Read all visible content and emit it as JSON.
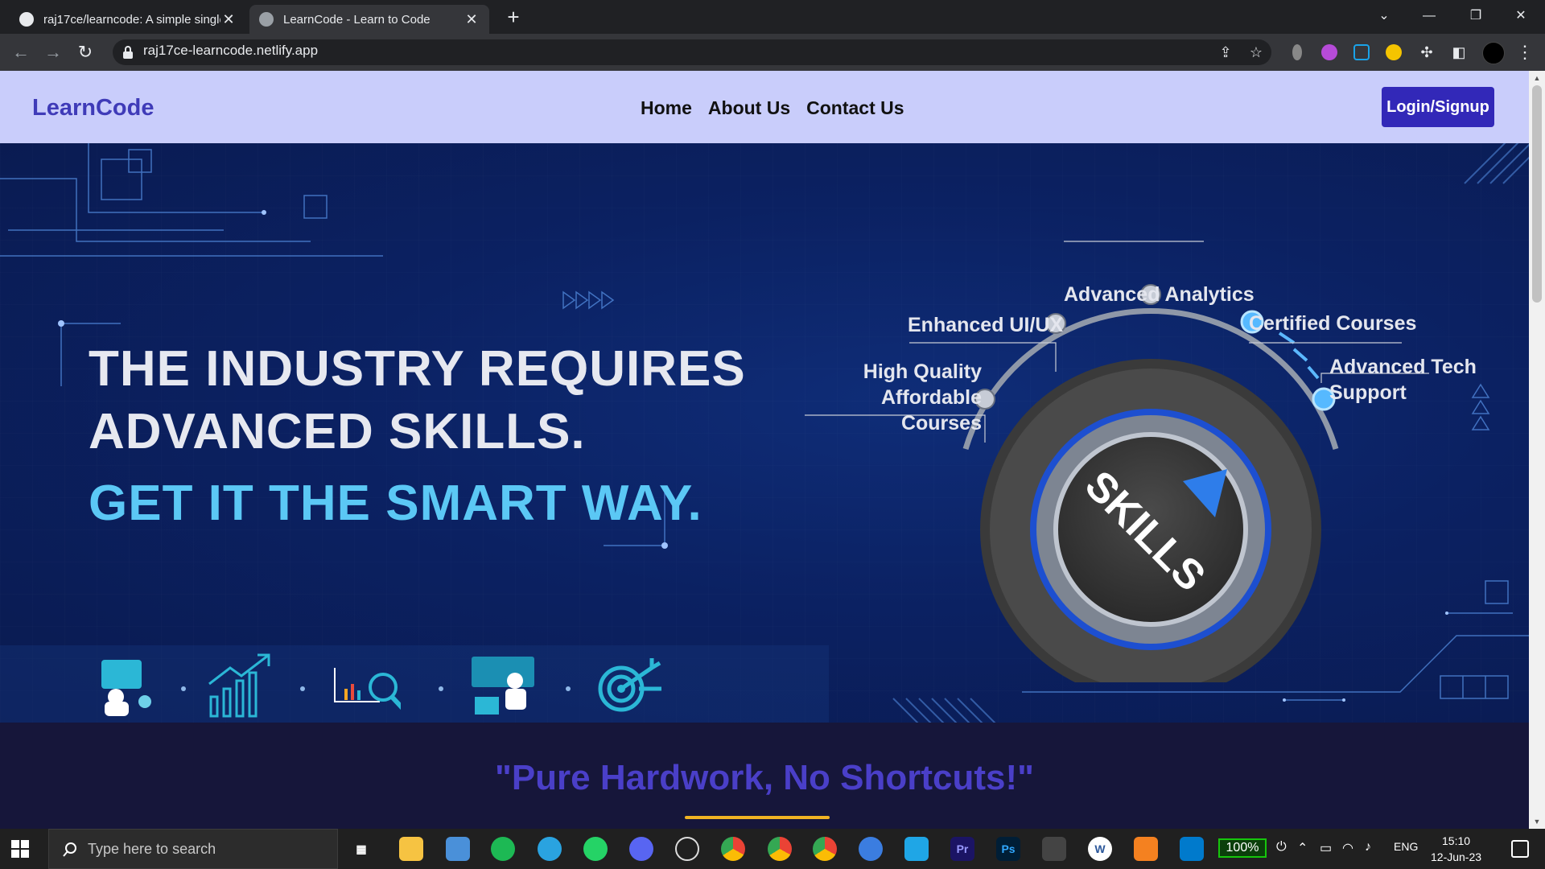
{
  "browser": {
    "tabs": [
      {
        "title": "raj17ce/learncode: A simple single",
        "favicon": "github-icon",
        "active": false
      },
      {
        "title": "LearnCode - Learn to Code",
        "favicon": "globe-icon",
        "active": true
      }
    ],
    "new_tab": "+",
    "url": "raj17ce-learncode.netlify.app"
  },
  "site": {
    "brand": "LearnCode",
    "nav": [
      "Home",
      "About Us",
      "Contact Us"
    ],
    "login_label": "Login/Signup",
    "brand_color": "#3f3bb8",
    "nav_bg": "#c9cdfb"
  },
  "hero": {
    "line1": "THE INDUSTRY REQUIRES",
    "line2": "ADVANCED SKILLS.",
    "line3": "GET IT THE SMART WAY.",
    "dial_text": "SKILLS",
    "skills": [
      "High Quality Affordable Courses",
      "Enhanced UI/UX",
      "Advanced Analytics",
      "Certified Courses",
      "Advanced Tech Support"
    ],
    "skill_lines": {
      "hq1": "High Quality",
      "hq2": "Affordable Courses",
      "ui": "Enhanced UI/UX",
      "aa": "Advanced Analytics",
      "cc": "Certified Courses",
      "ts1": "Advanced Tech",
      "ts2": "Support"
    },
    "accent_color": "#5bc8f5",
    "strip_icons": [
      "developer-icon",
      "growth-chart-icon",
      "analytics-magnifier-icon",
      "presentation-icon",
      "target-icon"
    ]
  },
  "section2": {
    "quote": "\"Pure Hardwork, No Shortcuts!\"",
    "underline_color": "#f0b323"
  },
  "taskbar": {
    "search_placeholder": "Type here to search",
    "battery": "100%",
    "language": "ENG",
    "time": "15:10",
    "date": "12-Jun-23",
    "apps": [
      "task-view-icon",
      "file-explorer-icon",
      "laptop-icon",
      "spotify-icon",
      "telegram-icon",
      "whatsapp-icon",
      "discord-icon",
      "obs-icon",
      "chrome-icon",
      "chrome-profile-icon",
      "chrome-alt-icon",
      "firefox-icon",
      "send-icon",
      "premiere-icon",
      "photoshop-icon",
      "terminal-icon",
      "word-icon",
      "sublime-icon",
      "vscode-icon"
    ]
  }
}
